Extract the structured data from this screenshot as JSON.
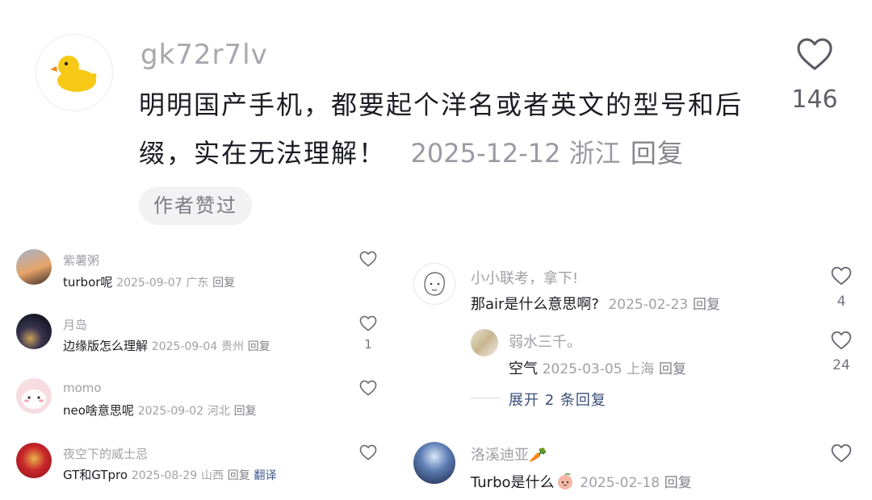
{
  "main_comment": {
    "username": "gk72r7lv",
    "text": "明明国产手机，都要起个洋名或者英文的型号和后缀，实在无法理解！",
    "date": "2025-12-12",
    "location": "浙江",
    "reply_label": "回复",
    "badge": "作者赞过",
    "likes": "146",
    "avatar_icon": "duck-icon"
  },
  "left_comments": [
    {
      "username": "紫薯粥",
      "text": "turbor呢",
      "date": "2025-09-07",
      "location": "广东",
      "reply_label": "回复",
      "likes": ""
    },
    {
      "username": "月岛",
      "text": "边缘版怎么理解",
      "date": "2025-09-04",
      "location": "贵州",
      "reply_label": "回复",
      "likes": "1"
    },
    {
      "username": "momo",
      "text": "neo啥意思呢",
      "date": "2025-09-02",
      "location": "河北",
      "reply_label": "回复",
      "likes": ""
    },
    {
      "username": "夜空下的威士忌",
      "text": "GT和GTpro",
      "date": "2025-08-29",
      "location": "山西",
      "reply_label": "回复",
      "translate_label": "翻译",
      "likes": ""
    }
  ],
  "right_comments": {
    "first": {
      "username": "小小联考，拿下!",
      "text": "那air是什么意思啊?",
      "date": "2025-02-23",
      "reply_label": "回复",
      "likes": "4"
    },
    "reply": {
      "username": "弱水三千。",
      "text": "空气",
      "date": "2025-03-05",
      "location": "上海",
      "reply_label": "回复",
      "likes": "24"
    },
    "expand_label": "展开 2 条回复",
    "second": {
      "username": "洛溪迪亚",
      "username_emoji": "🥕",
      "text": "Turbo是什么",
      "text_emoji": "peach-face-icon",
      "date": "2025-02-18",
      "reply_label": "回复",
      "likes": ""
    }
  },
  "colors": {
    "text": "#1c1c24",
    "meta": "#a0a0a8",
    "link": "#3a4f77",
    "badge_bg": "#f2f2f3"
  }
}
